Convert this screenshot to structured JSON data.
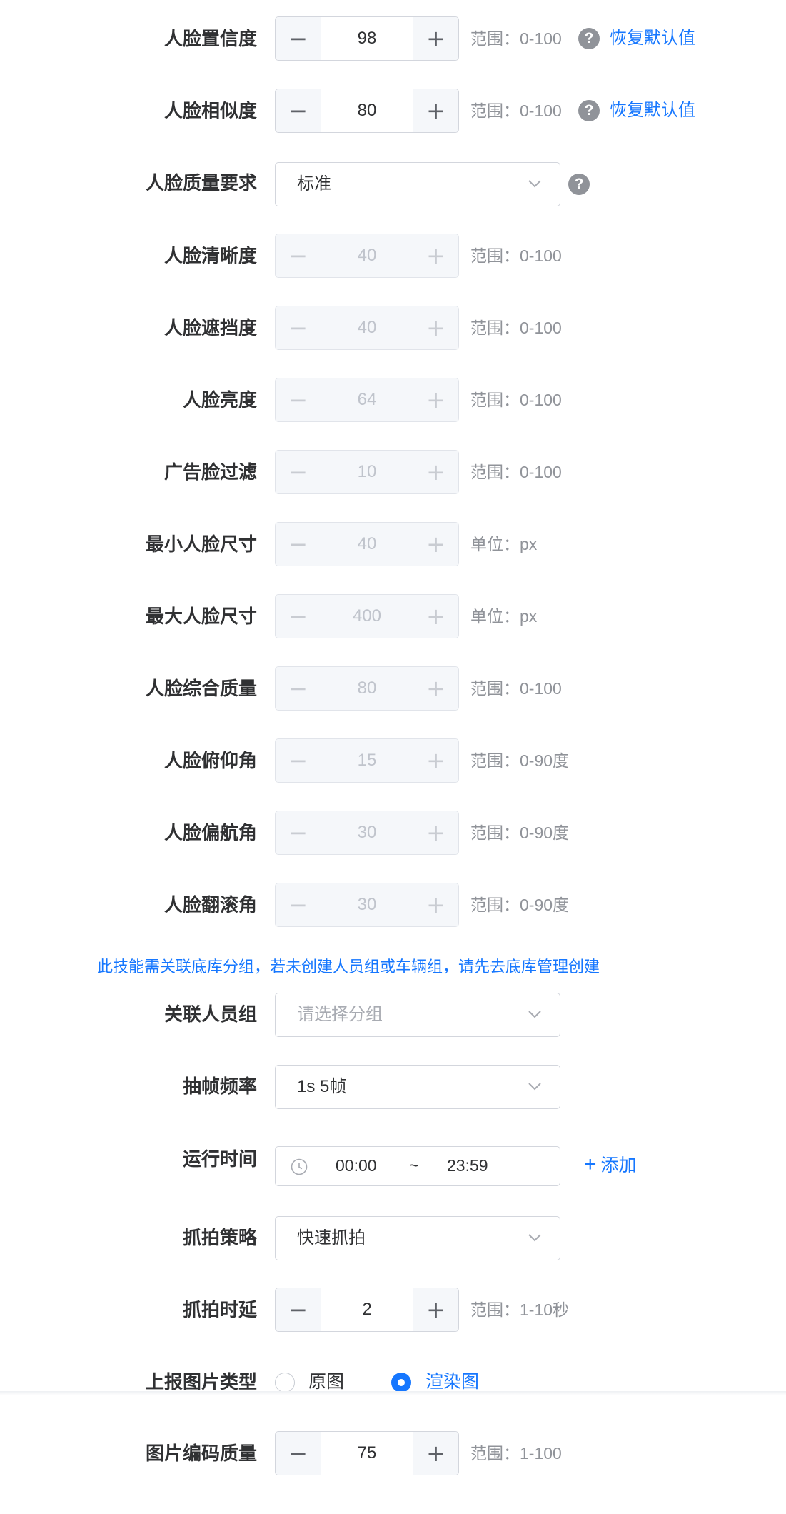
{
  "rows": [
    {
      "label": "人脸置信度",
      "value": "98",
      "hint": "范围：0-100",
      "link": "恢复默认值"
    },
    {
      "label": "人脸相似度",
      "value": "80",
      "hint": "范围：0-100",
      "link": "恢复默认值"
    },
    {
      "label": "人脸质量要求",
      "select": "标准"
    },
    {
      "label": "人脸清晰度",
      "value": "40",
      "hint": "范围：0-100"
    },
    {
      "label": "人脸遮挡度",
      "value": "40",
      "hint": "范围：0-100"
    },
    {
      "label": "人脸亮度",
      "value": "64",
      "hint": "范围：0-100"
    },
    {
      "label": "广告脸过滤",
      "value": "10",
      "hint": "范围：0-100"
    },
    {
      "label": "最小人脸尺寸",
      "value": "40",
      "hint": "单位：px"
    },
    {
      "label": "最大人脸尺寸",
      "value": "400",
      "hint": "单位：px"
    },
    {
      "label": "人脸综合质量",
      "value": "80",
      "hint": "范围：0-100"
    },
    {
      "label": "人脸俯仰角",
      "value": "15",
      "hint": "范围：0-90度"
    },
    {
      "label": "人脸偏航角",
      "value": "30",
      "hint": "范围：0-90度"
    },
    {
      "label": "人脸翻滚角",
      "value": "30",
      "hint": "范围：0-90度"
    }
  ],
  "notice": "此技能需关联底库分组，若未创建人员组或车辆组，请先去底库管理创建",
  "group": {
    "label": "关联人员组",
    "placeholder": "请选择分组"
  },
  "frame_rate": {
    "label": "抽帧频率",
    "value": "1s 5帧"
  },
  "run_time": {
    "label": "运行时间",
    "start": "00:00",
    "separator": "~",
    "end": "23:59",
    "add_label": "添加"
  },
  "strategy": {
    "label": "抓拍策略",
    "value": "快速抓拍"
  },
  "delay": {
    "label": "抓拍时延",
    "value": "2",
    "hint": "范围：1-10秒"
  },
  "image_type": {
    "label": "上报图片类型",
    "options": [
      "原图",
      "渲染图"
    ],
    "selected": "渲染图"
  },
  "encode_quality": {
    "label": "图片编码质量",
    "value": "75",
    "hint": "范围：1-100"
  },
  "symbols": {
    "minus": "−",
    "plus": "+",
    "help": "?",
    "add_plus": "+"
  },
  "colors": {
    "accent": "#1677ff",
    "label": "#303133",
    "hint": "#909399",
    "border": "#d3d6dd"
  }
}
